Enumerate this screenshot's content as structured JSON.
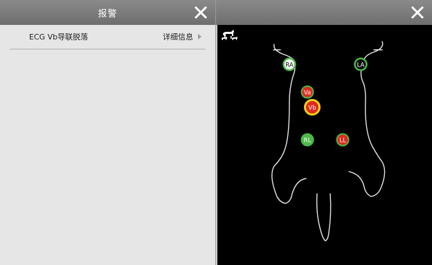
{
  "alarm_panel": {
    "title": "报警",
    "alarms": [
      {
        "message": "ECG Vb导联脱落",
        "detail_label": "详细信息"
      }
    ]
  },
  "body_panel": {
    "leads": [
      {
        "label": "RA",
        "status": "connected"
      },
      {
        "label": "LA",
        "status": "connected"
      },
      {
        "label": "Va",
        "status": "off"
      },
      {
        "label": "Vb",
        "status": "off-alarm"
      },
      {
        "label": "RL",
        "status": "connected"
      },
      {
        "label": "LL",
        "status": "off"
      }
    ]
  },
  "colors": {
    "header_bg": "#7c7c7c",
    "panel_bg": "#e6e6e6",
    "lead_connected": "#4db848",
    "lead_off": "#e0281e",
    "lead_alarm_ring": "#f2d21a"
  }
}
